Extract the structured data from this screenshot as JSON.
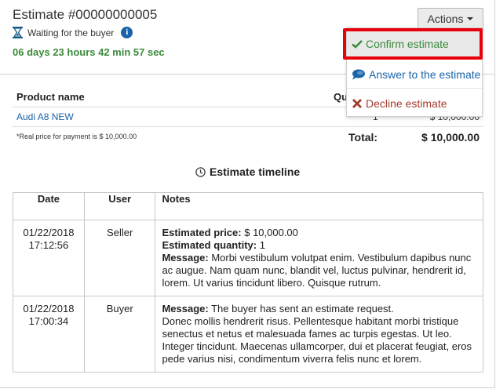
{
  "estimate": {
    "title": "Estimate #00000000005",
    "status": "Waiting for the buyer",
    "countdown": "06 days 23 hours 42 min 57 sec"
  },
  "actions": {
    "button_label": "Actions",
    "menu": [
      {
        "label": "Confirm estimate",
        "icon": "checkmark-icon"
      },
      {
        "label": "Answer to the estimate",
        "icon": "speech-bubble-icon"
      },
      {
        "label": "Decline estimate",
        "icon": "x-icon"
      }
    ]
  },
  "products": {
    "headers": [
      "Product name",
      "Qu"
    ],
    "rows": [
      {
        "name": "Audi A8 NEW",
        "qty": "1",
        "price": "$ 10,000.00"
      }
    ],
    "note": "*Real price for payment is $ 10,000.00",
    "total_label": "Total:",
    "total_value": "$ 10,000.00"
  },
  "timeline": {
    "title": "Estimate timeline",
    "headers": {
      "date": "Date",
      "user": "User",
      "notes": "Notes"
    },
    "rows": [
      {
        "date": "01/22/2018",
        "time": "17:12:56",
        "user": "Seller",
        "price_label": "Estimated price:",
        "price": " $ 10,000.00",
        "quantity_label": "Estimated quantity:",
        "quantity": " 1",
        "message_label": "Message:",
        "message": " Morbi vestibulum volutpat enim. Vestibulum dapibus nunc ac augue. Nam quam nunc, blandit vel, luctus pulvinar, hendrerit id, lorem. Ut varius tincidunt libero. Quisque rutrum."
      },
      {
        "date": "01/22/2018",
        "time": "17:00:34",
        "user": "Buyer",
        "message_label": "Message:",
        "message": " The buyer has sent an estimate request.",
        "message2": "Donec mollis hendrerit risus. Pellentesque habitant morbi tristique senectus et netus et malesuada fames ac turpis egestas. Ut leo. Integer tincidunt. Maecenas ullamcorper, dui et placerat feugiat, eros pede varius nisi, condimentum viverra felis nunc et lorem."
      }
    ]
  },
  "colors": {
    "accent_blue": "#1a63a8",
    "green": "#3b8a3b",
    "decline_red": "#a33a2e",
    "highlight_red": "#e8000b"
  }
}
